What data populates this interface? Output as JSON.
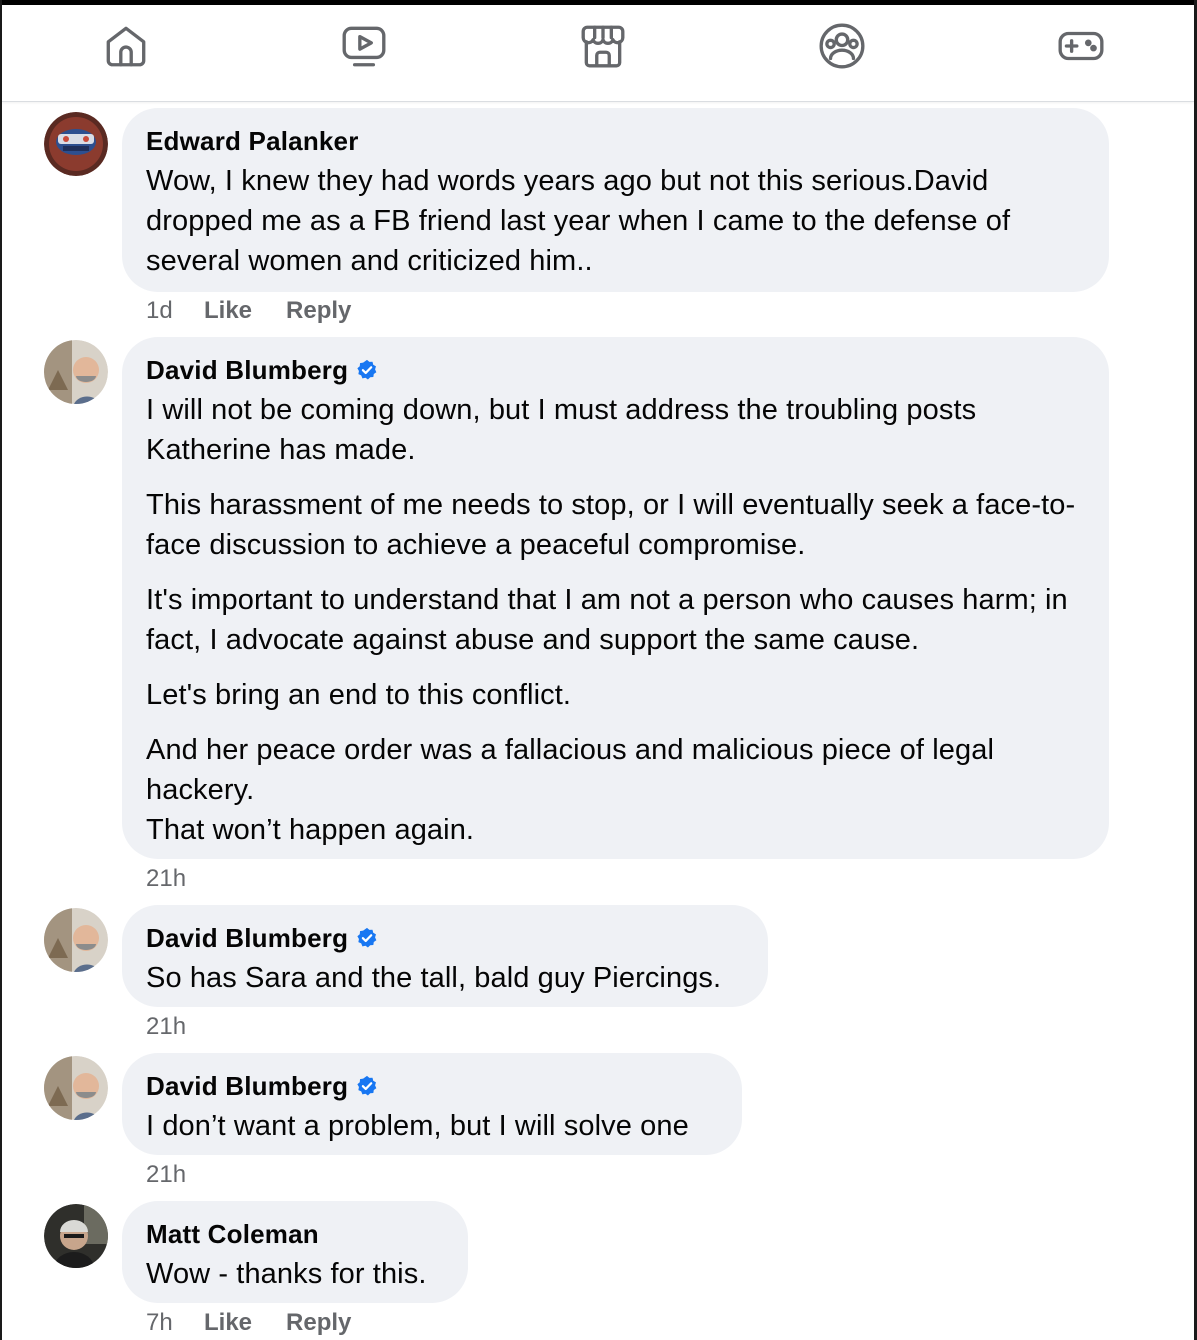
{
  "nav": {
    "tabs": [
      {
        "name": "home-icon"
      },
      {
        "name": "video-icon"
      },
      {
        "name": "marketplace-icon"
      },
      {
        "name": "groups-icon"
      },
      {
        "name": "gaming-icon"
      }
    ]
  },
  "actions": {
    "like": "Like",
    "reply": "Reply"
  },
  "comments": [
    {
      "author": "Edward Palanker",
      "verified": false,
      "paragraphs": [
        "Wow, I knew they had words years ago but not this serious.David dropped me as a FB friend last year when I came to the defense of several women and criticized him.."
      ],
      "time": "1d"
    },
    {
      "author": "David Blumberg",
      "verified": true,
      "paragraphs": [
        "I will not be coming down, but I must address the troubling posts Katherine has made.",
        "This harassment of me needs to stop, or I will eventually seek a face-to-face discussion to achieve a peaceful compromise.",
        "It's important to understand that I am not a person who causes harm; in fact, I advocate against abuse and support the same cause.",
        "Let's bring an end to this conflict.",
        "And her peace order was a fallacious and malicious piece of legal hackery.",
        "That won’t happen again."
      ],
      "time": "21h"
    },
    {
      "author": "David Blumberg",
      "verified": true,
      "paragraphs": [
        "So has Sara and the tall, bald guy Piercings."
      ],
      "time": "21h"
    },
    {
      "author": "David Blumberg",
      "verified": true,
      "paragraphs": [
        "I don’t want a problem, but I will solve one"
      ],
      "time": "21h"
    },
    {
      "author": "Matt Coleman",
      "verified": false,
      "paragraphs": [
        "Wow - thanks for this."
      ],
      "time": "7h"
    }
  ],
  "colors": {
    "bubble": "#eff1f5",
    "meta_text": "#65676b",
    "verified": "#1877f2",
    "icon": "#65676b"
  }
}
